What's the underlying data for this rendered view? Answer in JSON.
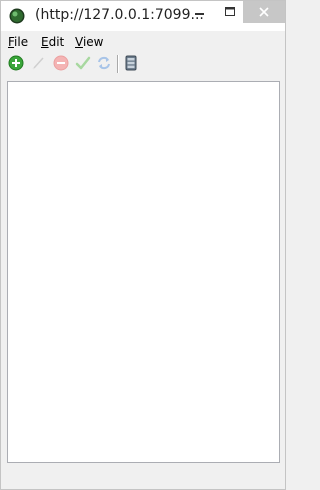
{
  "window": {
    "title": "(http://127.0.0.1:7099..."
  },
  "menu": {
    "items": [
      {
        "label": "File",
        "mnemonic": "F",
        "rest": "ile"
      },
      {
        "label": "Edit",
        "mnemonic": "E",
        "rest": "dit"
      },
      {
        "label": "View",
        "mnemonic": "V",
        "rest": "iew"
      }
    ]
  },
  "toolbar": {
    "buttons": [
      {
        "name": "add",
        "icon": "plus-circle-icon",
        "enabled": true,
        "color": "#3aa53a"
      },
      {
        "name": "edit",
        "icon": "pencil-icon",
        "enabled": false,
        "color": "#cfcfcf"
      },
      {
        "name": "remove",
        "icon": "minus-circle-icon",
        "enabled": false,
        "color": "#f0a0a0"
      },
      {
        "name": "accept",
        "icon": "checkmark-icon",
        "enabled": false,
        "color": "#a8d8a0"
      },
      {
        "name": "refresh",
        "icon": "refresh-icon",
        "enabled": false,
        "color": "#a8c4e8"
      },
      {
        "name": "database",
        "icon": "database-icon",
        "enabled": true,
        "color": "#6a7a8a"
      }
    ]
  },
  "colors": {
    "titlebar": "#ffffff",
    "close_button": "#c7c7c7",
    "chrome": "#f0f0f0",
    "pane": "#ffffff"
  }
}
